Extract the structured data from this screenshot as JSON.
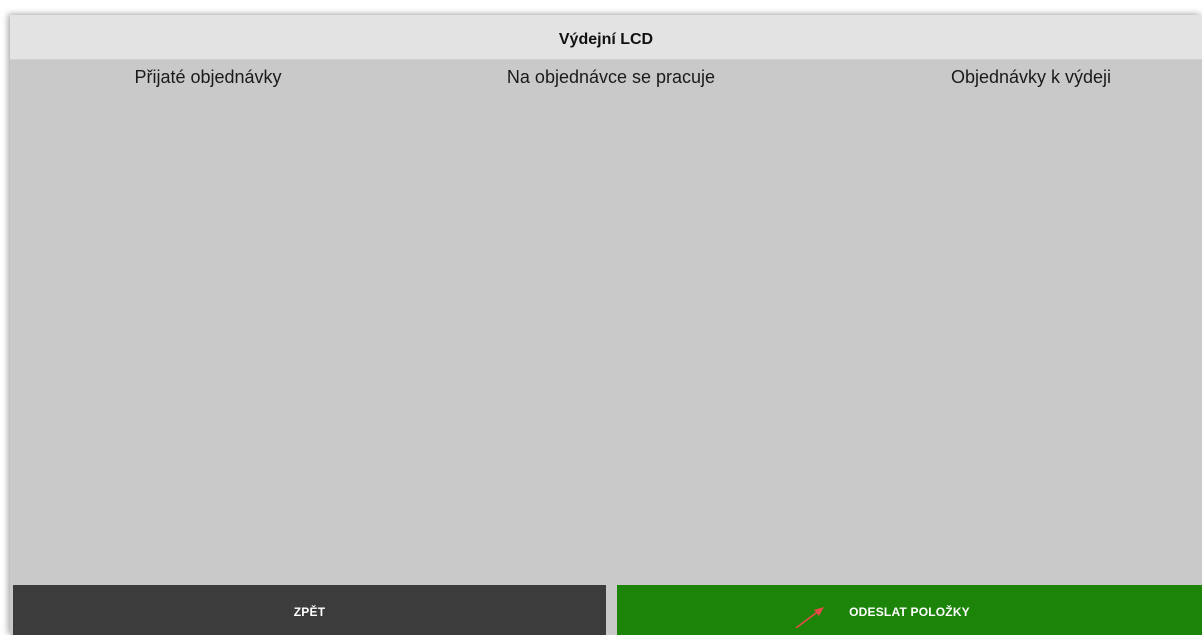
{
  "header": {
    "title": "Výdejní LCD"
  },
  "columns": [
    {
      "label": "Přijaté objednávky"
    },
    {
      "label": "Na objednávce se pracuje"
    },
    {
      "label": "Objednávky k výdeji"
    }
  ],
  "footer": {
    "back_label": "ZPĚT",
    "send_label": "ODESLAT POLOŽKY"
  },
  "colors": {
    "background": "#c9c9c9",
    "title_bar": "#e3e3e3",
    "back_button": "#3c3c3c",
    "send_button": "#1d840a",
    "annotation_arrow": "#e84a4a"
  },
  "icons": {
    "annotation": "arrow-annotation-icon"
  }
}
